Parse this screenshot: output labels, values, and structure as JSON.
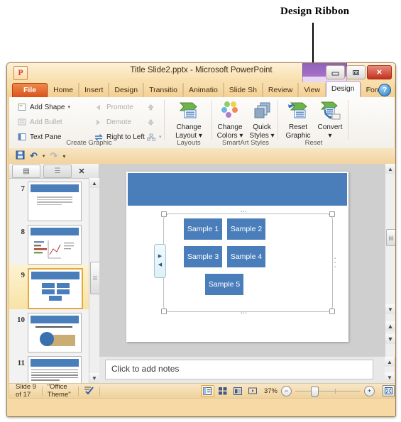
{
  "annotation": {
    "label": "Design Ribbon"
  },
  "window": {
    "title": "Title Slide2.pptx  -  Microsoft PowerPoint",
    "logo": "P",
    "controls": {
      "minimize": "minimize-icon",
      "restore": "restore-icon",
      "close": "✕"
    }
  },
  "tabs": {
    "file": "File",
    "items": [
      "Home",
      "Insert",
      "Design",
      "Transitio",
      "Animatio",
      "Slide Sh",
      "Review",
      "View"
    ],
    "contextual": [
      "Design",
      "Format"
    ],
    "active": "Design",
    "right_icons": {
      "collapse": "⌃",
      "help": "?"
    }
  },
  "ribbon": {
    "groups": [
      {
        "name": "Create Graphic",
        "items": [
          {
            "label": "Add Shape",
            "icon": "add-shape-icon",
            "dropdown": "▾",
            "disabled": false
          },
          {
            "label": "Promote",
            "icon": "promote-icon",
            "disabled": true
          },
          {
            "label": "Move Up",
            "icon": "move-up-icon",
            "disabled": true
          },
          {
            "label": "Add Bullet",
            "icon": "add-bullet-icon",
            "disabled": true
          },
          {
            "label": "Demote",
            "icon": "demote-icon",
            "disabled": true
          },
          {
            "label": "Move Down",
            "icon": "move-down-icon",
            "disabled": true
          },
          {
            "label": "Text Pane",
            "icon": "text-pane-icon",
            "disabled": false
          },
          {
            "label": "Right to Left",
            "icon": "right-to-left-icon",
            "disabled": false
          },
          {
            "label": "Layout",
            "icon": "org-layout-icon",
            "dropdown": "▾",
            "disabled": true
          }
        ]
      },
      {
        "name": "Layouts",
        "buttons": [
          {
            "line1": "Change",
            "line2": "Layout ▾",
            "icon": "change-layout-icon"
          }
        ]
      },
      {
        "name": "SmartArt Styles",
        "buttons": [
          {
            "line1": "Change",
            "line2": "Colors ▾",
            "icon": "change-colors-icon"
          },
          {
            "line1": "Quick",
            "line2": "Styles ▾",
            "icon": "quick-styles-icon"
          }
        ]
      },
      {
        "name": "Reset",
        "buttons": [
          {
            "line1": "Reset",
            "line2": "Graphic",
            "icon": "reset-graphic-icon"
          },
          {
            "line1": "Convert",
            "line2": "▾",
            "icon": "convert-icon"
          }
        ]
      }
    ]
  },
  "quick_access": {
    "items": [
      {
        "name": "save-icon",
        "glyph": "💾"
      },
      {
        "name": "undo-icon",
        "glyph": "↶"
      },
      {
        "name": "undo-dropdown-icon",
        "glyph": "▾"
      },
      {
        "name": "redo-icon",
        "glyph": "↷"
      },
      {
        "name": "customize-qat-icon",
        "glyph": "▾"
      }
    ]
  },
  "thumbnail_pane": {
    "tabs": [
      {
        "name": "slides-tab",
        "label": "▤",
        "active": true
      },
      {
        "name": "outline-tab",
        "label": "☰",
        "active": false
      }
    ],
    "close": "✕",
    "slides": [
      {
        "number": "7",
        "type": "text",
        "selected": false
      },
      {
        "number": "8",
        "type": "chart",
        "selected": false
      },
      {
        "number": "9",
        "type": "smartart",
        "selected": true
      },
      {
        "number": "10",
        "type": "image",
        "selected": false
      },
      {
        "number": "11",
        "type": "paragraph",
        "selected": false
      }
    ],
    "scroll": {
      "up": "▲",
      "down": "▼"
    }
  },
  "slide": {
    "title_placeholder": "",
    "smartart": {
      "boxes": [
        "Sample 1",
        "Sample 2",
        "Sample 3",
        "Sample 4",
        "Sample 5"
      ],
      "box_color": "#4a7ebb",
      "text_pane_tab": {
        "open": "▶",
        "close": "◀"
      }
    }
  },
  "notes": {
    "placeholder": "Click to add notes"
  },
  "status_bar": {
    "slide_counter": "Slide 9 of 17",
    "theme": "\"Office Theme\"",
    "spellcheck_icon": "spellcheck-icon",
    "views": [
      {
        "name": "normal-view-button",
        "glyph": "▥",
        "active": true
      },
      {
        "name": "slide-sorter-button",
        "glyph": "⌸",
        "active": false
      },
      {
        "name": "reading-view-button",
        "glyph": "▤",
        "active": false
      },
      {
        "name": "slide-show-button",
        "glyph": "☐",
        "active": false
      }
    ],
    "zoom_value": "37%",
    "zoom_out": "−",
    "zoom_in": "+",
    "fit_window": "fit-slide-icon"
  },
  "scrollbars": {
    "slide_up": "▲",
    "slide_down": "▼",
    "prev_slide": "⌃",
    "next_slide": "⌄"
  }
}
